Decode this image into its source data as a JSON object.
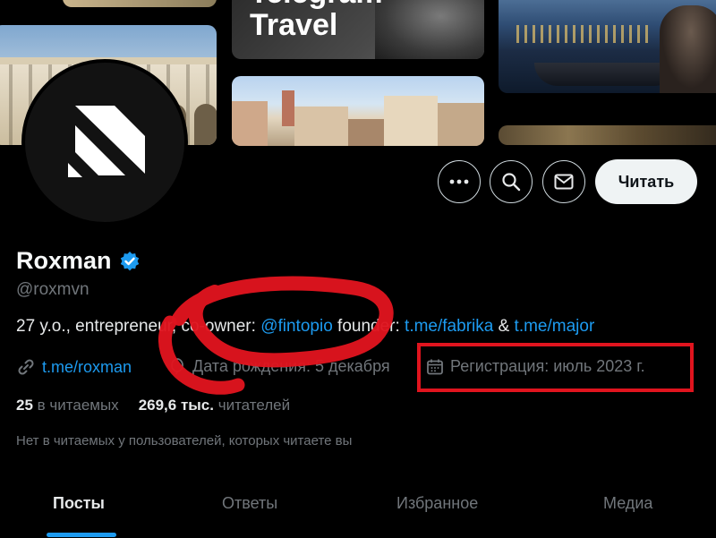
{
  "banner": {
    "tile_text_line1": "Telegram",
    "tile_text_line2": "Travel"
  },
  "actions": {
    "more_icon": "more-horizontal-icon",
    "search_icon": "search-icon",
    "message_icon": "envelope-icon",
    "follow_label": "Читать"
  },
  "profile": {
    "display_name": "Roxman",
    "verified_icon": "verified-badge-icon",
    "handle": "@roxmvn",
    "bio": {
      "part1": "27 y.o., entrepreneur, co-owner: ",
      "mention": "@fintopio",
      "part2": " founder: ",
      "link1": "t.me/fabrika",
      "amp": " & ",
      "link2": "t.me/major"
    },
    "website": "t.me/roxman",
    "birthday": "Дата рождения: 5 декабря",
    "joined": "Регистрация: июль 2023 г.",
    "following_count": "25",
    "following_label": "в читаемых",
    "followers_count": "269,6 тыс.",
    "followers_label": "читателей",
    "followers_note": "Нет в читаемых у пользователей, которых читаете вы"
  },
  "tabs": [
    {
      "label": "Посты",
      "active": true
    },
    {
      "label": "Ответы",
      "active": false
    },
    {
      "label": "Избранное",
      "active": false
    },
    {
      "label": "Медиа",
      "active": false
    }
  ],
  "colors": {
    "background": "#000000",
    "link": "#1d9bf0",
    "muted": "#71767b",
    "annotation": "#e0141e"
  }
}
